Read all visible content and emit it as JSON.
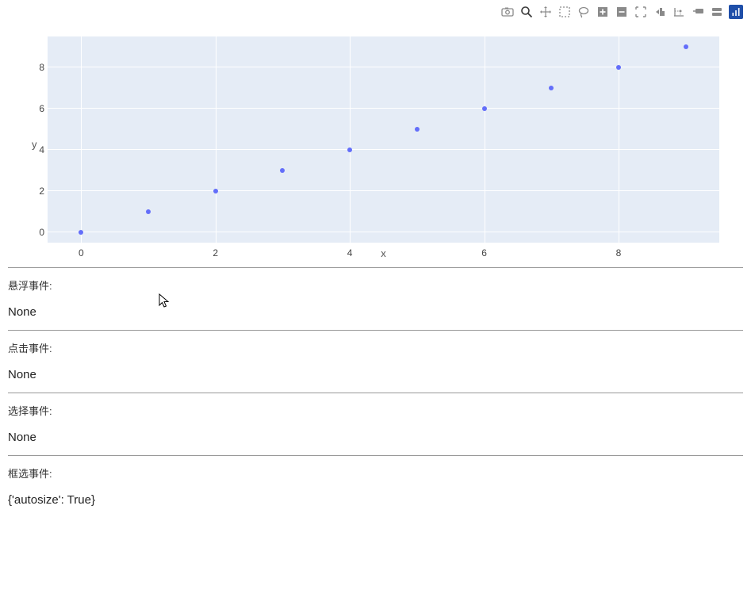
{
  "toolbar": {
    "items": [
      {
        "name": "camera-icon"
      },
      {
        "name": "zoom-icon",
        "active": true
      },
      {
        "name": "pan-icon"
      },
      {
        "name": "box-select-icon"
      },
      {
        "name": "lasso-select-icon"
      },
      {
        "name": "zoom-in-icon"
      },
      {
        "name": "zoom-out-icon"
      },
      {
        "name": "autoscale-icon"
      },
      {
        "name": "reset-axes-icon"
      },
      {
        "name": "spike-lines-icon"
      },
      {
        "name": "hover-closest-icon"
      },
      {
        "name": "hover-compare-icon"
      },
      {
        "name": "plotly-logo-icon",
        "logo": true
      }
    ]
  },
  "chart_data": {
    "type": "scatter",
    "x": [
      0,
      1,
      2,
      3,
      4,
      5,
      6,
      7,
      8,
      9
    ],
    "y": [
      0,
      1,
      2,
      3,
      4,
      5,
      6,
      7,
      8,
      9
    ],
    "xlabel": "x",
    "ylabel": "y",
    "xticks": [
      0,
      2,
      4,
      6,
      8
    ],
    "yticks": [
      0,
      2,
      4,
      6,
      8
    ],
    "xlim": [
      -0.5,
      9.5
    ],
    "ylim": [
      -0.5,
      9.5
    ],
    "marker_color": "#636efa",
    "bg_color": "#e5ecf6"
  },
  "events": {
    "hover": {
      "label": "悬浮事件:",
      "value": "None"
    },
    "click": {
      "label": "点击事件:",
      "value": "None"
    },
    "select": {
      "label": "选择事件:",
      "value": "None"
    },
    "relayout": {
      "label": "框选事件:",
      "value": "{'autosize': True}"
    }
  }
}
